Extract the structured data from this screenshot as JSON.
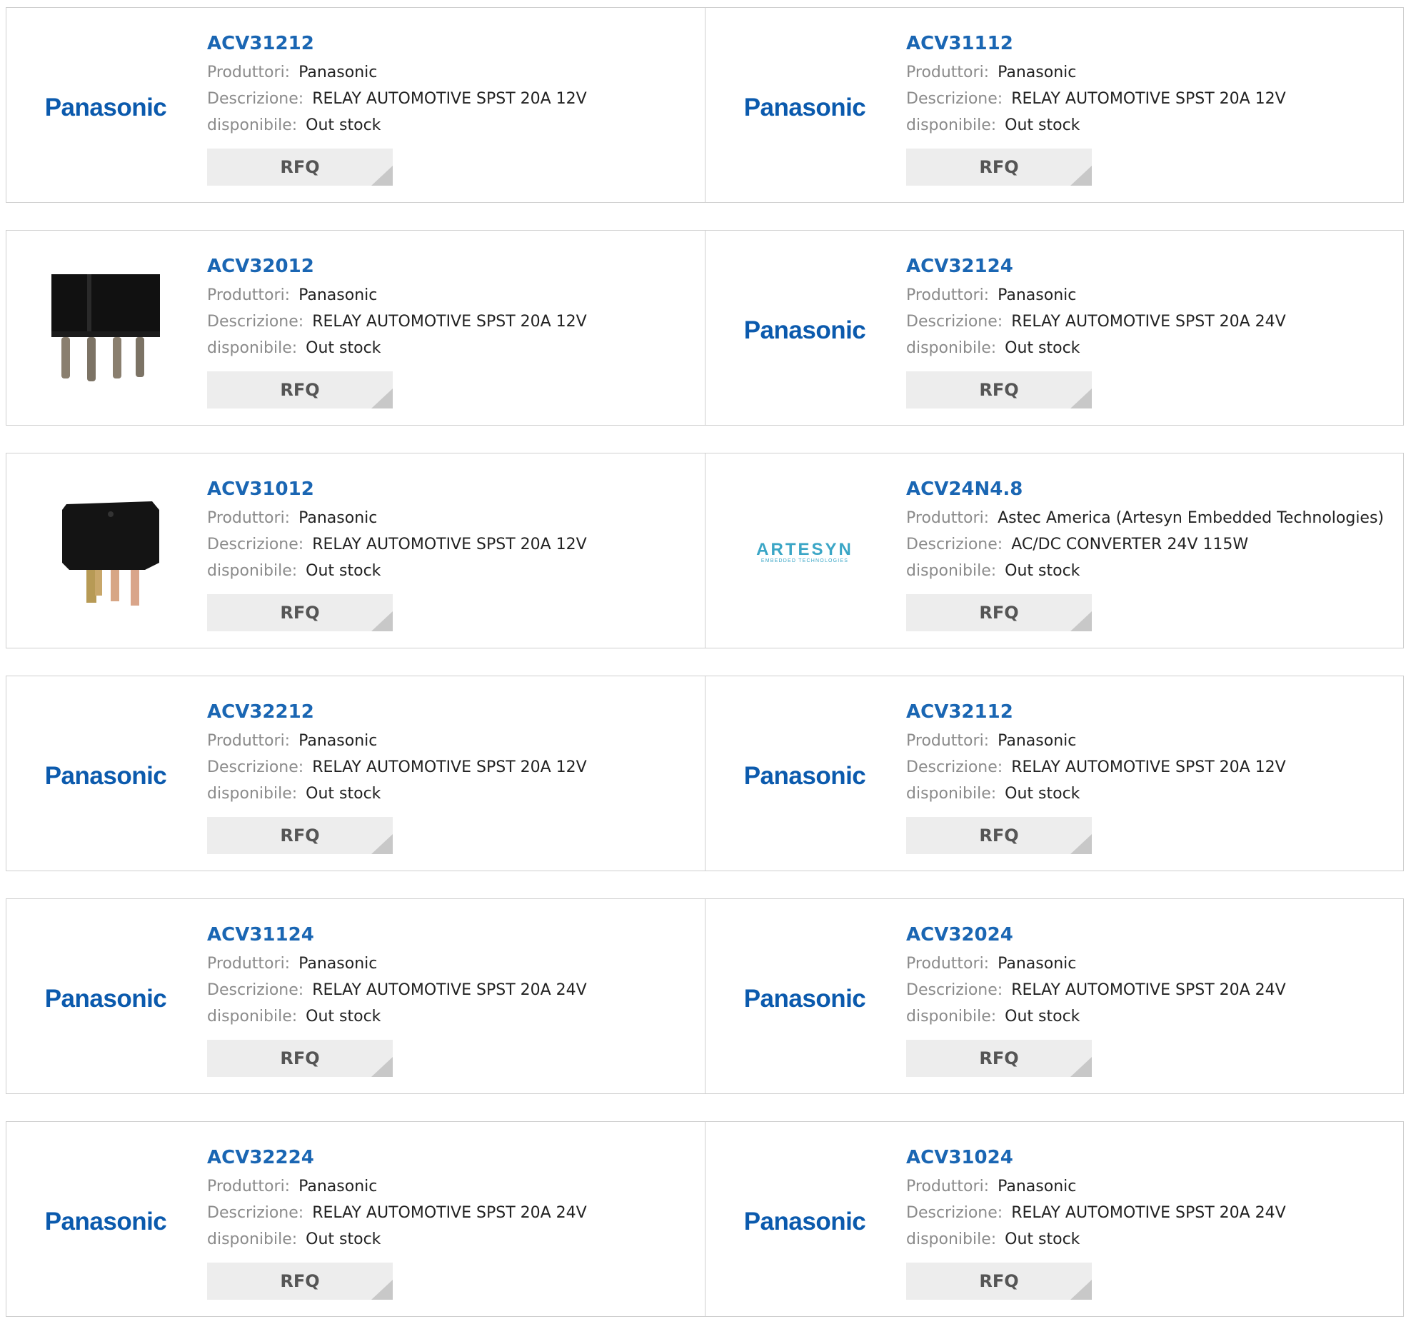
{
  "labels": {
    "manufacturer": "Produttori:",
    "description": "Descrizione:",
    "availability": "disponibile:",
    "rfq": "RFQ"
  },
  "products": [
    {
      "part": "ACV31212",
      "manufacturer": "Panasonic",
      "description": "RELAY AUTOMOTIVE SPST 20A 12V",
      "availability": "Out stock",
      "image": "panasonic-logo"
    },
    {
      "part": "ACV31112",
      "manufacturer": "Panasonic",
      "description": "RELAY AUTOMOTIVE SPST 20A 12V",
      "availability": "Out stock",
      "image": "panasonic-logo"
    },
    {
      "part": "ACV32012",
      "manufacturer": "Panasonic",
      "description": "RELAY AUTOMOTIVE SPST 20A 12V",
      "availability": "Out stock",
      "image": "relay-photo-four-pin"
    },
    {
      "part": "ACV32124",
      "manufacturer": "Panasonic",
      "description": "RELAY AUTOMOTIVE SPST 20A 24V",
      "availability": "Out stock",
      "image": "panasonic-logo"
    },
    {
      "part": "ACV31012",
      "manufacturer": "Panasonic",
      "description": "RELAY AUTOMOTIVE SPST 20A 12V",
      "availability": "Out stock",
      "image": "relay-photo-cube"
    },
    {
      "part": "ACV24N4.8",
      "manufacturer": "Astec America (Artesyn Embedded Technologies)",
      "description": "AC/DC CONVERTER 24V 115W",
      "availability": "Out stock",
      "image": "artesyn-logo"
    },
    {
      "part": "ACV32212",
      "manufacturer": "Panasonic",
      "description": "RELAY AUTOMOTIVE SPST 20A 12V",
      "availability": "Out stock",
      "image": "panasonic-logo"
    },
    {
      "part": "ACV32112",
      "manufacturer": "Panasonic",
      "description": "RELAY AUTOMOTIVE SPST 20A 12V",
      "availability": "Out stock",
      "image": "panasonic-logo"
    },
    {
      "part": "ACV31124",
      "manufacturer": "Panasonic",
      "description": "RELAY AUTOMOTIVE SPST 20A 24V",
      "availability": "Out stock",
      "image": "panasonic-logo"
    },
    {
      "part": "ACV32024",
      "manufacturer": "Panasonic",
      "description": "RELAY AUTOMOTIVE SPST 20A 24V",
      "availability": "Out stock",
      "image": "panasonic-logo"
    },
    {
      "part": "ACV32224",
      "manufacturer": "Panasonic",
      "description": "RELAY AUTOMOTIVE SPST 20A 24V",
      "availability": "Out stock",
      "image": "panasonic-logo"
    },
    {
      "part": "ACV31024",
      "manufacturer": "Panasonic",
      "description": "RELAY AUTOMOTIVE SPST 20A 24V",
      "availability": "Out stock",
      "image": "panasonic-logo"
    }
  ],
  "logos": {
    "panasonic": "Panasonic",
    "artesyn_main": "ARTESYN",
    "artesyn_sub": "EMBEDDED TECHNOLOGIES"
  },
  "colors": {
    "part_link": "#1a66b3",
    "panasonic_logo": "#0b5aad",
    "artesyn_logo": "#3ba6c6",
    "label_gray": "#8b8b8b",
    "rfq_bg": "#ededed"
  }
}
